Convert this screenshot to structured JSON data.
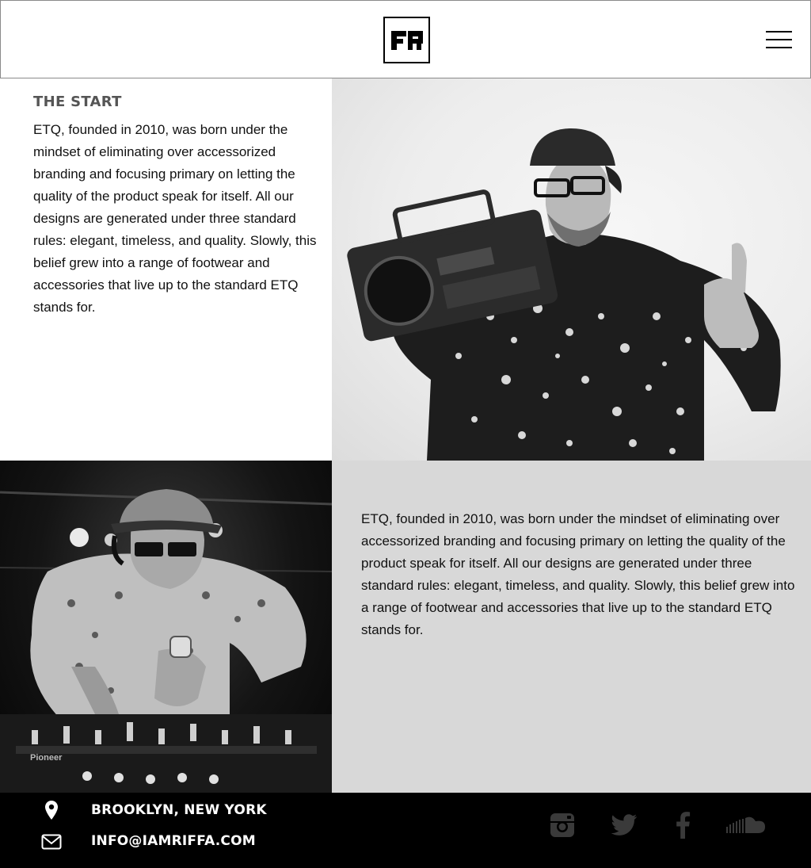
{
  "header": {
    "logo_alt": "FR",
    "menu_icon": "hamburger-menu-icon"
  },
  "section_start": {
    "title": "THE START",
    "body": "ETQ, founded in 2010, was born under the mindset of eliminating over accessorized branding and focusing primary on letting the quality of the product speak for itself. All our designs are generated under three standard rules: elegant, timeless, and quality. Slowly, this belief grew into a range of footwear and accessories that live up to the standard ETQ stands for."
  },
  "section_second": {
    "body": "ETQ, founded in 2010, was born under the mindset of eliminating over accessorized branding and focusing primary on letting the quality of the product speak for itself. All our designs are generated under three standard rules: elegant, timeless, and quality. Slowly, this belief grew into a range of footwear and accessories that live up to the standard ETQ stands for."
  },
  "photos": {
    "photo1_label": "man-with-boombox-photo",
    "photo2_label": "dj-at-mixer-photo"
  },
  "footer": {
    "location": "BROOKLYN, NEW YORK",
    "email": "INFO@IAMRIFFA.COM",
    "location_icon": "map-pin-icon",
    "email_icon": "envelope-icon",
    "social": [
      "instagram-icon",
      "twitter-icon",
      "facebook-icon",
      "soundcloud-icon"
    ],
    "social_color": "#3a3a3a"
  }
}
